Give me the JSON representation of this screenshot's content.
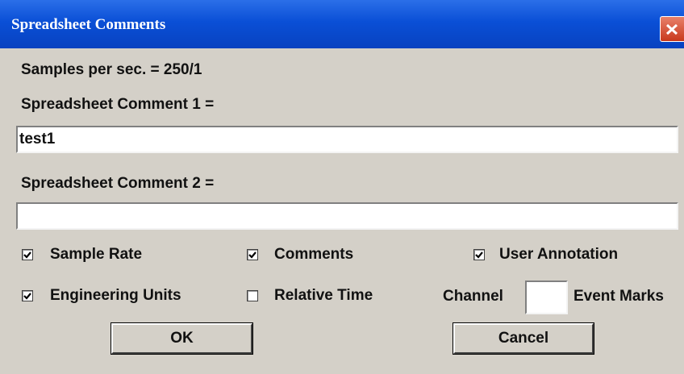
{
  "window": {
    "title": "Spreadsheet Comments",
    "title_bar_color": "#0a4fd6",
    "close_icon": "close-icon"
  },
  "info": {
    "samples_label": "Samples per sec. = 250/1"
  },
  "comment1": {
    "label": "Spreadsheet Comment 1 =",
    "value": "test1"
  },
  "comment2": {
    "label": "Spreadsheet Comment 2 =",
    "value": ""
  },
  "options": {
    "sample_rate": {
      "label": "Sample Rate",
      "checked": true
    },
    "comments": {
      "label": "Comments",
      "checked": true
    },
    "user_annotation": {
      "label": "User Annotation",
      "checked": true
    },
    "engineering_units": {
      "label": "Engineering Units",
      "checked": true
    },
    "relative_time": {
      "label": "Relative Time",
      "checked": false
    }
  },
  "event_marks": {
    "channel_label": "Channel",
    "suffix_label": "Event Marks",
    "channel_value": ""
  },
  "buttons": {
    "ok": "OK",
    "cancel": "Cancel"
  }
}
